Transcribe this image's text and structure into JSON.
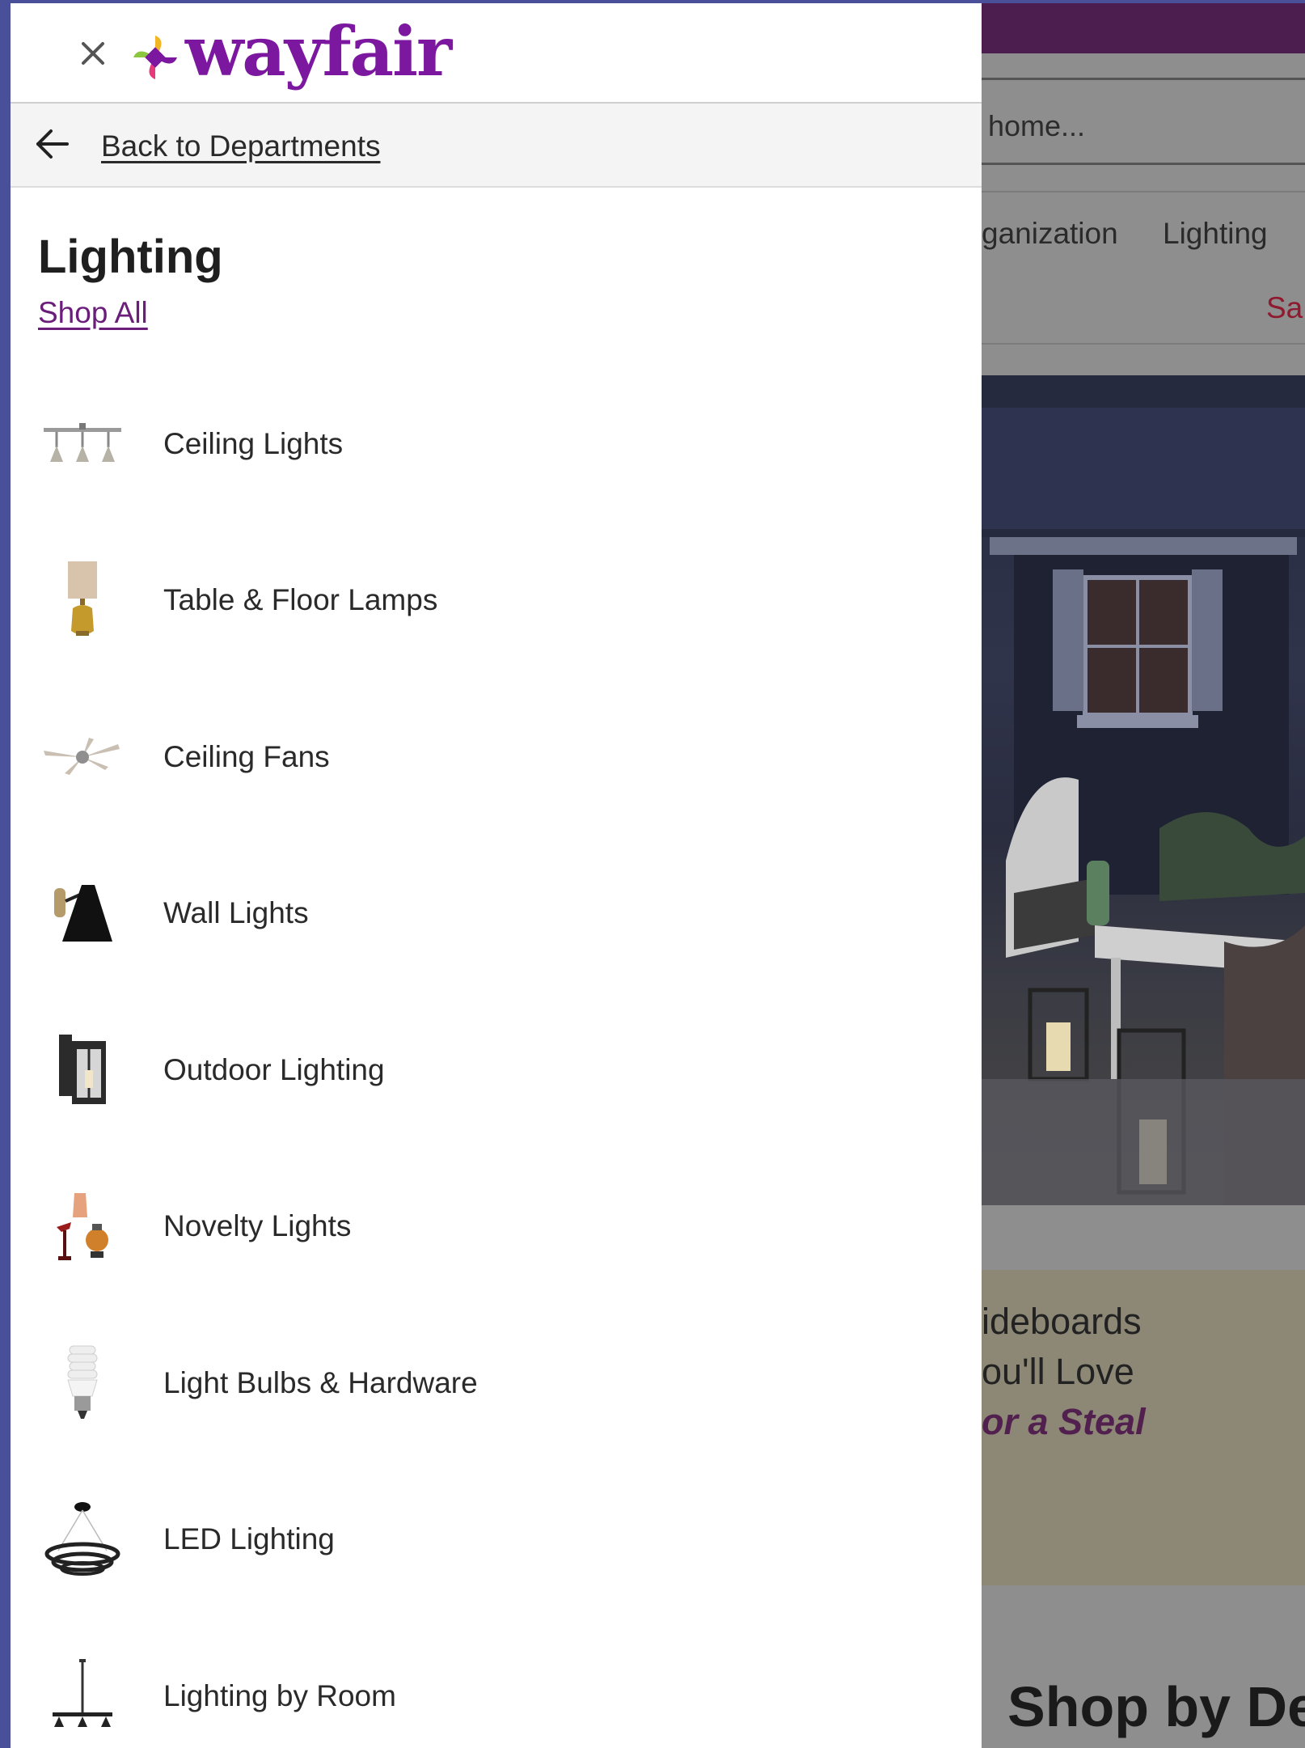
{
  "background": {
    "search_text": "home...",
    "nav_items": [
      "ganization",
      "Lighting"
    ],
    "nav_sale": "Sa",
    "banner_lines": [
      "ideboards",
      "ou'll Love",
      "or a Steal"
    ],
    "shop_by": "Shop by De"
  },
  "drawer": {
    "logo_text": "wayfair",
    "back_label": "Back to Departments",
    "title": "Lighting",
    "shop_all": "Shop All",
    "categories": [
      {
        "label": "Ceiling Lights",
        "icon": "ceiling-light-icon"
      },
      {
        "label": "Table & Floor Lamps",
        "icon": "table-lamp-icon"
      },
      {
        "label": "Ceiling Fans",
        "icon": "ceiling-fan-icon"
      },
      {
        "label": "Wall Lights",
        "icon": "wall-light-icon"
      },
      {
        "label": "Outdoor Lighting",
        "icon": "outdoor-lantern-icon"
      },
      {
        "label": "Novelty Lights",
        "icon": "novelty-light-icon"
      },
      {
        "label": "Light Bulbs & Hardware",
        "icon": "light-bulb-icon"
      },
      {
        "label": "LED Lighting",
        "icon": "led-ring-light-icon"
      },
      {
        "label": "Lighting by Room",
        "icon": "pendant-light-icon"
      }
    ]
  },
  "colors": {
    "brand_purple": "#7b189f",
    "topbar_purple": "#4c1e4f",
    "link_purple": "#6a1e7a",
    "sale_red": "#8e1a30"
  }
}
